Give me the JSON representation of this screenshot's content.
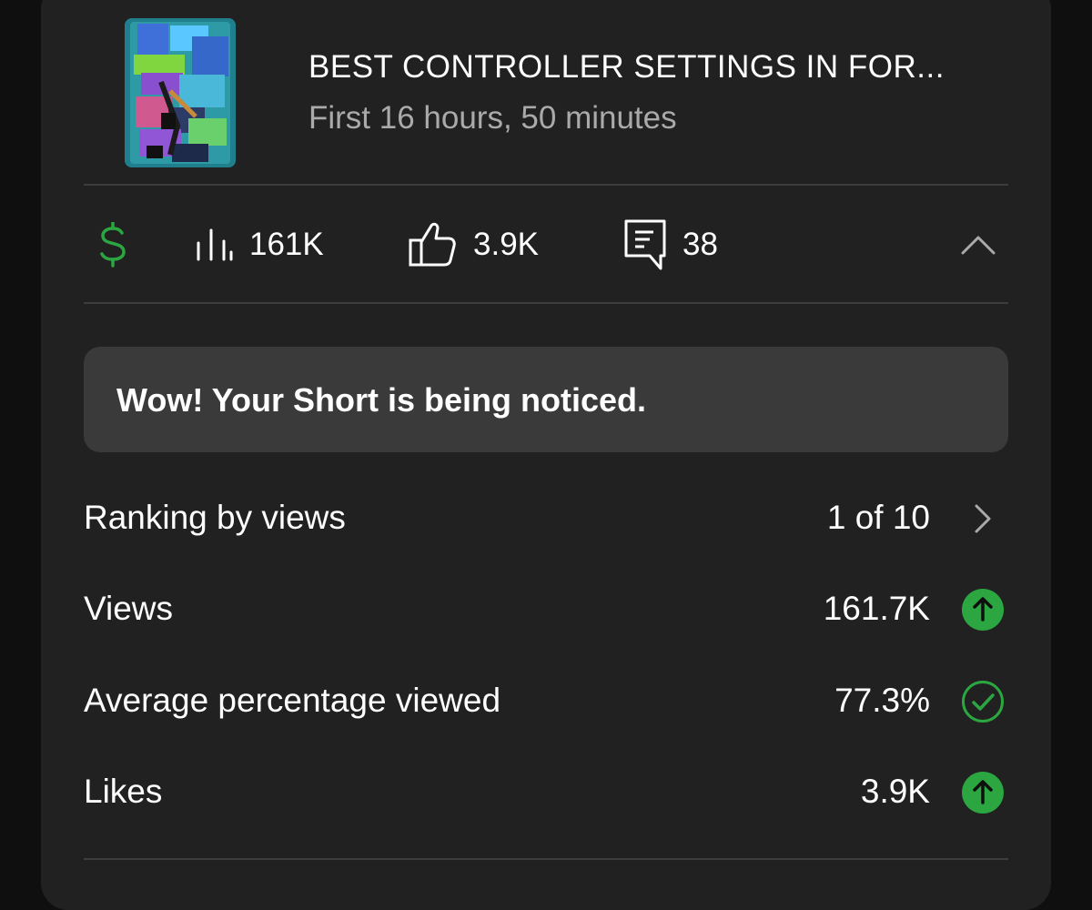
{
  "video": {
    "title": "BEST CONTROLLER SETTINGS IN FOR...",
    "subtitle": "First 16 hours, 50 minutes"
  },
  "stats": {
    "views": "161K",
    "likes": "3.9K",
    "comments": "38",
    "icons": [
      "dollar-icon",
      "bar-chart-icon",
      "thumbs-up-icon",
      "comment-icon",
      "chevron-up-icon"
    ]
  },
  "banner": {
    "text": "Wow! Your Short is being noticed."
  },
  "metrics": [
    {
      "label": "Ranking by views",
      "value": "1 of 10",
      "icon": "chevron-right-icon"
    },
    {
      "label": "Views",
      "value": "161.7K",
      "icon": "up-arrow-icon"
    },
    {
      "label": "Average percentage viewed",
      "value": "77.3%",
      "icon": "check-circle-icon"
    },
    {
      "label": "Likes",
      "value": "3.9K",
      "icon": "up-arrow-icon"
    }
  ],
  "colors": {
    "card_background": "#212121",
    "page_background": "#0f0f0f",
    "banner_background": "#3a3a3a",
    "accent_green": "#2ba640",
    "divider": "#3d3d3d",
    "secondary_text": "#aaaaaa"
  }
}
